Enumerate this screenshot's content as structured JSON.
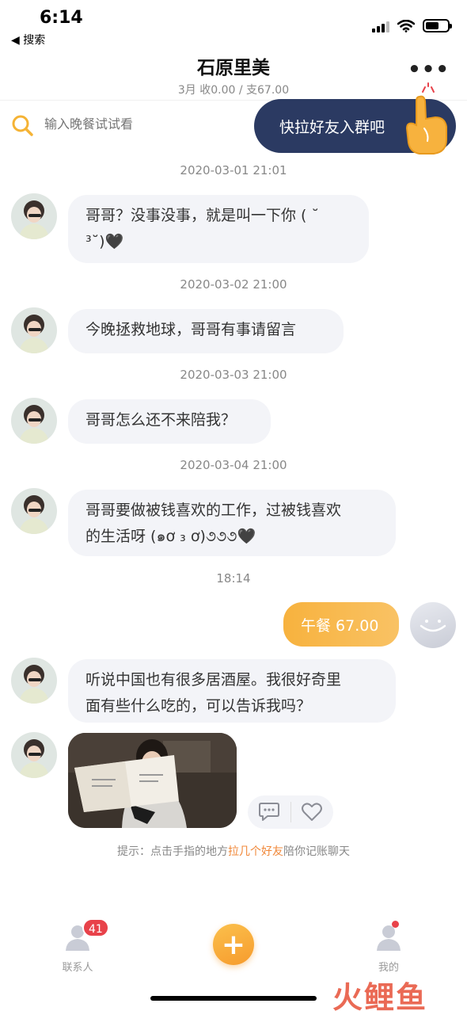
{
  "status_bar": {
    "time": "6:14",
    "back_label": "◀ 搜索"
  },
  "header": {
    "title": "石原里美",
    "subtitle": "3月 收0.00 / 支67.00",
    "more_label": "•••"
  },
  "search": {
    "placeholder": "输入晚餐试试看"
  },
  "invite_banner": {
    "label": "快拉好友入群吧"
  },
  "messages": [
    {
      "time": "2020-03-01 21:01",
      "text_line1": "哥哥？没事没事，就是叫一下你 ( ˘",
      "text_line2": "³˘)🖤"
    },
    {
      "time": "2020-03-02 21:00",
      "text": "今晚拯救地球，哥哥有事请留言"
    },
    {
      "time": "2020-03-03 21:00",
      "text": "哥哥怎么还不来陪我？"
    },
    {
      "time": "2020-03-04 21:00",
      "text_line1": "哥哥要做被钱喜欢的工作，过被钱喜欢",
      "text_line2": "的生活呀 (๑ơ ₃ ơ)૭૭૭🖤"
    },
    {
      "time": "18:14",
      "outgoing_text": "午餐 67.00"
    },
    {
      "text_line1": "听说中国也有很多居酒屋。我很好奇里",
      "text_line2": "面有些什么吃的，可以告诉我吗？"
    }
  ],
  "hint": {
    "prefix": "提示：点击手指的地方",
    "highlight": "拉几个好友",
    "suffix": "陪你记账聊天"
  },
  "tabbar": {
    "contacts_label": "联系人",
    "contacts_badge": "41",
    "add_label": "+",
    "mine_label": "我的"
  },
  "watermark": "火鲤鱼",
  "colors": {
    "accent": "#f7b23e",
    "banner": "#2b3a62",
    "badge": "#e8424a",
    "hint_highlight": "#f0883a"
  }
}
